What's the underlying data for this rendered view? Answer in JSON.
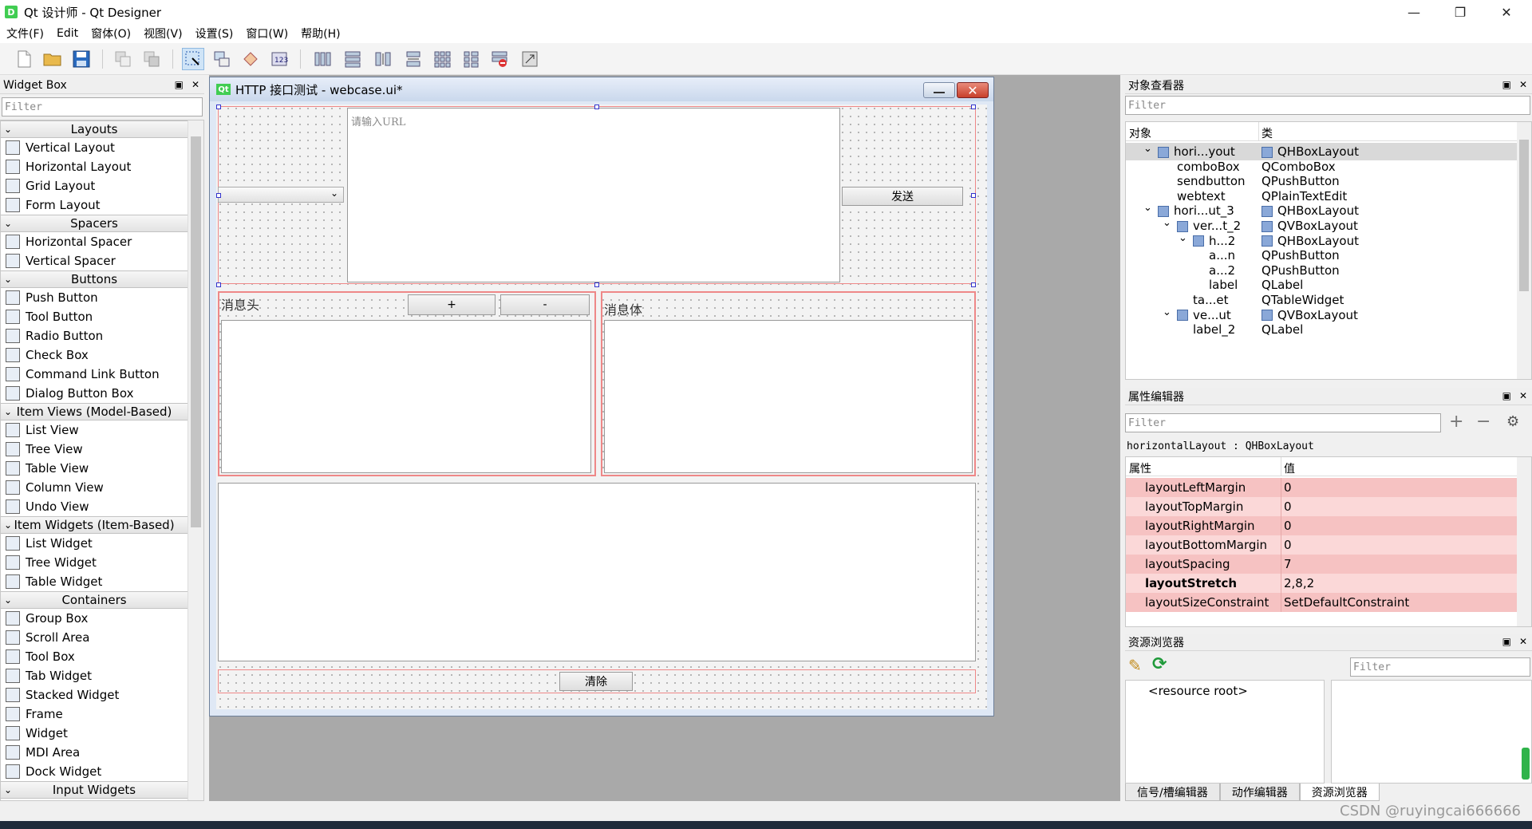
{
  "window": {
    "title": "Qt 设计师 - Qt Designer",
    "icon_label": "D",
    "minimize_glyph": "—",
    "maximize_glyph": "❐",
    "close_glyph": "✕"
  },
  "menu": [
    "文件(F)",
    "Edit",
    "窗体(O)",
    "视图(V)",
    "设置(S)",
    "窗口(W)",
    "帮助(H)"
  ],
  "widget_box": {
    "title": "Widget Box",
    "filter_placeholder": "Filter",
    "categories": [
      {
        "name": "Layouts",
        "items": [
          "Vertical Layout",
          "Horizontal Layout",
          "Grid Layout",
          "Form Layout"
        ]
      },
      {
        "name": "Spacers",
        "items": [
          "Horizontal Spacer",
          "Vertical Spacer"
        ]
      },
      {
        "name": "Buttons",
        "items": [
          "Push Button",
          "Tool Button",
          "Radio Button",
          "Check Box",
          "Command Link Button",
          "Dialog Button Box"
        ]
      },
      {
        "name": "Item Views (Model-Based)",
        "items": [
          "List View",
          "Tree View",
          "Table View",
          "Column View",
          "Undo View"
        ]
      },
      {
        "name": "Item Widgets (Item-Based)",
        "items": [
          "List Widget",
          "Tree Widget",
          "Table Widget"
        ]
      },
      {
        "name": "Containers",
        "items": [
          "Group Box",
          "Scroll Area",
          "Tool Box",
          "Tab Widget",
          "Stacked Widget",
          "Frame",
          "Widget",
          "MDI Area",
          "Dock Widget"
        ]
      },
      {
        "name": "Input Widgets",
        "items": []
      }
    ]
  },
  "form": {
    "title": "HTTP 接口测试 - webcase.ui*",
    "icon_label": "Qt",
    "close_glyph": "✕",
    "url_placeholder": "请输入URL",
    "send_label": "发送",
    "header_label": "消息头",
    "plus_label": "+",
    "minus_label": "-",
    "body_label": "消息体",
    "clear_label": "清除"
  },
  "object_inspector": {
    "title": "对象查看器",
    "filter_placeholder": "Filter",
    "col_object": "对象",
    "col_class": "类",
    "rows": [
      {
        "obj": "hori...yout",
        "cls": "QHBoxLayout",
        "expander": "v",
        "selected": true
      },
      {
        "obj": "comboBox",
        "cls": "QComboBox"
      },
      {
        "obj": "sendbutton",
        "cls": "QPushButton"
      },
      {
        "obj": "webtext",
        "cls": "QPlainTextEdit"
      },
      {
        "obj": "hori...ut_3",
        "cls": "QHBoxLayout",
        "expander": "v"
      },
      {
        "obj": "ver...t_2",
        "cls": "QVBoxLayout",
        "expander": "v"
      },
      {
        "obj": "h...2",
        "cls": "QHBoxLayout",
        "expander": "v"
      },
      {
        "obj": "a...n",
        "cls": "QPushButton"
      },
      {
        "obj": "a...2",
        "cls": "QPushButton"
      },
      {
        "obj": "label",
        "cls": "QLabel"
      },
      {
        "obj": "ta...et",
        "cls": "QTableWidget"
      },
      {
        "obj": "ve...ut",
        "cls": "QVBoxLayout",
        "expander": "v"
      },
      {
        "obj": "label_2",
        "cls": "QLabel"
      }
    ]
  },
  "property_editor": {
    "title": "属性编辑器",
    "filter_placeholder": "Filter",
    "object_caption": "horizontalLayout : QHBoxLayout",
    "col_property": "属性",
    "col_value": "值",
    "rows": [
      {
        "name": "layoutLeftMargin",
        "value": "0"
      },
      {
        "name": "layoutTopMargin",
        "value": "0"
      },
      {
        "name": "layoutRightMargin",
        "value": "0"
      },
      {
        "name": "layoutBottomMargin",
        "value": "0"
      },
      {
        "name": "layoutSpacing",
        "value": "7"
      },
      {
        "name": "layoutStretch",
        "value": "2,8,2",
        "bold": true
      },
      {
        "name": "layoutSizeConstraint",
        "value": "SetDefaultConstraint"
      }
    ]
  },
  "resource_browser": {
    "title": "资源浏览器",
    "filter_placeholder": "Filter",
    "root_label": "<resource root>"
  },
  "bottom_tabs": [
    "信号/槽编辑器",
    "动作编辑器",
    "资源浏览器"
  ],
  "watermark": "CSDN @ruyingcai666666"
}
